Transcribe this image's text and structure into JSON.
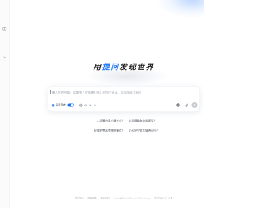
{
  "theme": {
    "accent": "#1772F6",
    "text": "#1a1a1a",
    "muted": "#9aa0aa"
  },
  "sidebar": {
    "items": [
      {
        "icon": "sidebar-toggle-icon"
      },
      {
        "icon": "chevron-down-icon"
      }
    ]
  },
  "hero": {
    "prefix": "用",
    "highlight": "提问",
    "suffix": "发现世界"
  },
  "search": {
    "placeholder": "输入你的问题，或使用「@快捷引用」对知乎答主、知识库进行提问",
    "deep_think": {
      "icon": "deep-think-icon",
      "label": "深度思考",
      "enabled": true
    },
    "tools": [
      {
        "icon": "globe-icon"
      },
      {
        "icon": "book-icon"
      },
      {
        "icon": "image-icon"
      },
      {
        "icon": "more-icon"
      }
    ],
    "actions": [
      {
        "icon": "at-icon"
      },
      {
        "icon": "attachment-icon"
      },
      {
        "icon": "send-icon"
      }
    ]
  },
  "suggestions": [
    {
      "text": "人活着的意义是什么？"
    },
    {
      "text": "上班摸鱼会被发现吗？"
    },
    {
      "text": "好看的电影有哪些推荐？"
    },
    {
      "text": "小米SU7新车值得买吗？"
    }
  ],
  "footer": {
    "links": [
      "用户协议",
      "隐私政策",
      "联系我们",
      "Beijing Zhizhe Tianxia Technology",
      "京ICP证110745号"
    ]
  }
}
